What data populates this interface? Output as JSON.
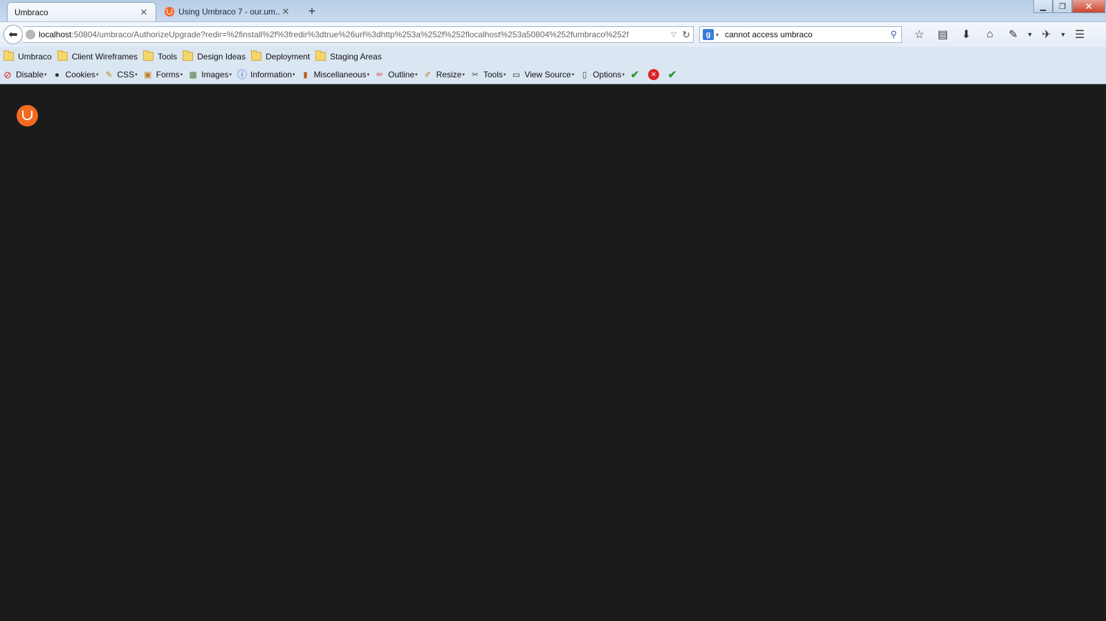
{
  "tabs": [
    {
      "label": "Umbraco",
      "active": true
    },
    {
      "label": "Using Umbraco 7 - our.um...",
      "active": false
    }
  ],
  "new_tab_label": "+",
  "window_controls": {
    "minimize": "▁",
    "restore": "❐",
    "close": "✕"
  },
  "navigation": {
    "url_host": "localhost",
    "url_rest": ":50804/umbraco/AuthorizeUpgrade?redir=%2finstall%2f%3fredir%3dtrue%26url%3dhttp%253a%252f%252flocalhost%253a50804%252fumbraco%252f",
    "search_query": "cannot access umbraco",
    "search_engine": "g"
  },
  "bookmarks": [
    "Umbraco",
    "Client Wireframes",
    "Tools",
    "Design Ideas",
    "Deployment",
    "Staging Areas"
  ],
  "devtoolbar": [
    {
      "label": "Disable",
      "icon": "disable-icon"
    },
    {
      "label": "Cookies",
      "icon": "cookies-icon"
    },
    {
      "label": "CSS",
      "icon": "css-icon"
    },
    {
      "label": "Forms",
      "icon": "forms-icon"
    },
    {
      "label": "Images",
      "icon": "images-icon"
    },
    {
      "label": "Information",
      "icon": "information-icon"
    },
    {
      "label": "Miscellaneous",
      "icon": "miscellaneous-icon"
    },
    {
      "label": "Outline",
      "icon": "outline-icon"
    },
    {
      "label": "Resize",
      "icon": "resize-icon"
    },
    {
      "label": "Tools",
      "icon": "tools-icon"
    },
    {
      "label": "View Source",
      "icon": "view-source-icon"
    },
    {
      "label": "Options",
      "icon": "options-icon"
    }
  ],
  "colors": {
    "page_background": "#1b1b1b",
    "umbraco_orange": "#f36b21"
  }
}
